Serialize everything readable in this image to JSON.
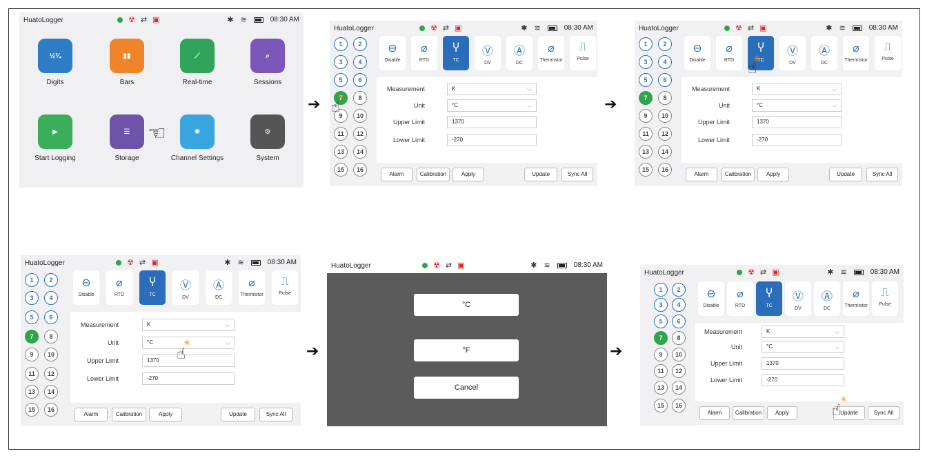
{
  "app_title": "HuatoLogger",
  "time": "08:30 AM",
  "home": {
    "apps": [
      {
        "label": "Digits",
        "glyph": "½¾"
      },
      {
        "label": "Bars",
        "glyph": "▮▮"
      },
      {
        "label": "Real-time",
        "glyph": "⟋"
      },
      {
        "label": "Sessions",
        "glyph": "⌕"
      },
      {
        "label": "Start Logging",
        "glyph": "▶"
      },
      {
        "label": "Storage",
        "glyph": "☰"
      },
      {
        "label": "Channel Settings",
        "glyph": "✺"
      },
      {
        "label": "System",
        "glyph": "⚙"
      }
    ]
  },
  "channels": [
    "1",
    "2",
    "3",
    "4",
    "5",
    "6",
    "7",
    "8",
    "9",
    "10",
    "11",
    "12",
    "13",
    "14",
    "15",
    "16"
  ],
  "types": [
    "Disable",
    "RTD",
    "TC",
    "DV",
    "DC",
    "Thermistor",
    "Pulse"
  ],
  "fields": {
    "measurement_label": "Measurement",
    "measurement_value": "K",
    "unit_label": "Unit",
    "unit_value": "°C",
    "upper_label": "Upper Limit",
    "upper_value": "1370",
    "lower_label": "Lower Limit",
    "lower_value": "-270"
  },
  "buttons": {
    "alarm": "Alarm",
    "calibration": "Calibration",
    "apply": "Apply",
    "update": "Update",
    "sync_all": "Sync All"
  },
  "dialog": {
    "celsius": "°C",
    "fahrenheit": "°F",
    "cancel": "Cancel"
  },
  "colors": {
    "accent": "#2a6ebb",
    "active_channel": "#2fa44f",
    "dialog_backdrop": "#5b5b5b"
  }
}
